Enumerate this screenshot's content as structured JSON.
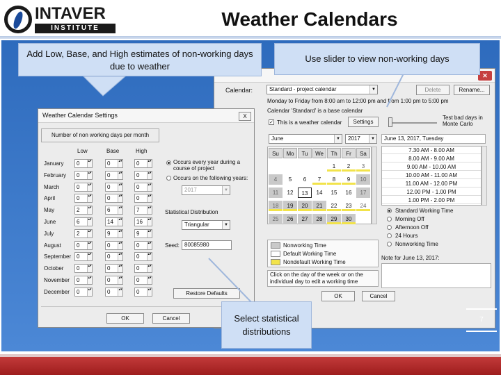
{
  "logo": {
    "word": "INTAVER",
    "sub": "INSTITUTE"
  },
  "title": "Weather Calendars",
  "callouts": {
    "estimates": "Add Low, Base, and High estimates of non-working days due to weather",
    "slider": "Use slider to view non-working days",
    "distributions": "Select statistical distributions"
  },
  "page_number": "7",
  "calendar_window": {
    "calendar_label": "Calendar:",
    "calendar_value": "Standard - project calendar",
    "delete_label": "Delete",
    "rename_label": "Rename...",
    "hours_line": "Monday to Friday from 8:00 am to 12:00 pm and from 1:00 pm to 5:00 pm",
    "base_line": "Calendar 'Standard' is a base calendar",
    "weather_check_label": "This is a weather calendar",
    "settings_label": "Settings",
    "test_bad_label": "Test bad days in Monte Carlo",
    "month": "June",
    "year": "2017",
    "day_headers": [
      "Su",
      "Mo",
      "Tu",
      "We",
      "Th",
      "Fr",
      "Sa"
    ],
    "weeks": [
      [
        "",
        "",
        "",
        "",
        "1",
        "2",
        "3"
      ],
      [
        "4",
        "5",
        "6",
        "7",
        "8",
        "9",
        "10"
      ],
      [
        "11",
        "12",
        "13",
        "14",
        "15",
        "16",
        "17"
      ],
      [
        "18",
        "19",
        "20",
        "21",
        "22",
        "23",
        "24"
      ],
      [
        "25",
        "26",
        "27",
        "28",
        "29",
        "30",
        ""
      ]
    ],
    "date_header": "June 13, 2017, Tuesday",
    "time_slots": [
      "7.30 AM - 8.00 AM",
      "8.00 AM - 9.00 AM",
      "9.00 AM - 10.00 AM",
      "10.00 AM - 11.00 AM",
      "11.00 AM - 12.00 PM",
      "12.00 PM - 1.00 PM",
      "1.00 PM - 2.00 PM"
    ],
    "day_types": [
      "Standard Working Time",
      "Morning Off",
      "Afternoon Off",
      "24 Hours",
      "Nonworking Time"
    ],
    "legend": [
      "Nonworking Time",
      "Default Working Time",
      "Nondefault Working Time"
    ],
    "hint": "Click on the day of the week or on the individual day to edit a working time",
    "note_label": "Note for June 13, 2017:",
    "ok_label": "OK",
    "cancel_label": "Cancel"
  },
  "settings_window": {
    "title": "Weather Calendar Settings",
    "close_glyph": "X",
    "header": "Number of non working days per month",
    "columns": [
      "Low",
      "Base",
      "High"
    ],
    "months": [
      {
        "name": "January",
        "low": "0",
        "base": "0",
        "high": "0"
      },
      {
        "name": "February",
        "low": "0",
        "base": "0",
        "high": "0"
      },
      {
        "name": "March",
        "low": "0",
        "base": "0",
        "high": "0"
      },
      {
        "name": "April",
        "low": "0",
        "base": "0",
        "high": "0"
      },
      {
        "name": "May",
        "low": "2",
        "base": "6",
        "high": "7"
      },
      {
        "name": "June",
        "low": "6",
        "base": "14",
        "high": "16"
      },
      {
        "name": "July",
        "low": "2",
        "base": "9",
        "high": "9"
      },
      {
        "name": "August",
        "low": "0",
        "base": "0",
        "high": "0"
      },
      {
        "name": "September",
        "low": "0",
        "base": "0",
        "high": "0"
      },
      {
        "name": "October",
        "low": "0",
        "base": "0",
        "high": "0"
      },
      {
        "name": "November",
        "low": "0",
        "base": "0",
        "high": "0"
      },
      {
        "name": "December",
        "low": "0",
        "base": "0",
        "high": "0"
      }
    ],
    "occurs_every_year": "Occurs every year during a course of project",
    "occurs_following": "Occurs on the following years:",
    "year_value": "2017",
    "distribution_label": "Statistical Distribution",
    "distribution_value": "Triangular",
    "seed_label": "Seed:",
    "seed_value": "80085980",
    "restore_label": "Restore Defaults",
    "ok_label": "OK",
    "cancel_label": "Cancel"
  },
  "colors": {
    "panel": "#3a78c9",
    "nonworking": "#c9c9c9",
    "weather_day": "#f2e34a",
    "bottom_bar": "#b02a2a"
  }
}
